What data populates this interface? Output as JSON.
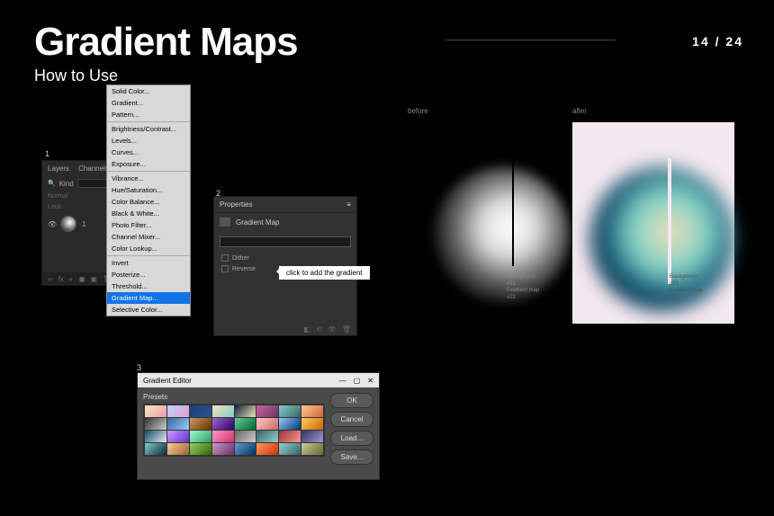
{
  "header": {
    "title": "Gradient Maps",
    "subtitle": "How to Use"
  },
  "page": {
    "current": "14",
    "sep": " / ",
    "total": "24"
  },
  "steps": {
    "s1": "1",
    "s2": "2",
    "s3": "3"
  },
  "layers": {
    "tab1": "Layers",
    "tab2": "Channels",
    "kind_label": "Kind",
    "blend": "Normal",
    "lock": "Lock:",
    "layer_name": "1",
    "footer_icons": [
      "∞",
      "fx",
      "◐",
      "◼",
      "▣",
      "🗑"
    ]
  },
  "context_menu": {
    "items": [
      "Solid Color...",
      "Gradient...",
      "Pattern...",
      "Brightness/Contrast...",
      "Levels...",
      "Curves...",
      "Exposure...",
      "Vibrance...",
      "Hue/Saturation...",
      "Color Balance...",
      "Black & White...",
      "Photo Filter...",
      "Channel Mixer...",
      "Color Lookup...",
      "Invert",
      "Posterize...",
      "Threshold...",
      "Gradient Map...",
      "Selective Color..."
    ],
    "highlighted_index": 17,
    "separators_after": [
      2,
      6,
      13
    ]
  },
  "properties": {
    "title": "Properties",
    "sub": "Gradient Map",
    "dither": "Dither",
    "reverse": "Reverse",
    "tooltip": "click to add the gradient"
  },
  "gradient_editor": {
    "title": "Gradient Editor",
    "min": "—",
    "max": "▢",
    "close": "✕",
    "presets_label": "Presets",
    "buttons": {
      "ok": "OK",
      "cancel": "Cancel",
      "load": "Load...",
      "save": "Save..."
    },
    "swatches": [
      "linear-gradient(135deg,#fce9b5,#e89cb5)",
      "linear-gradient(135deg,#b5d7fc,#e89ccc)",
      "linear-gradient(135deg,#1e3c72,#2a5298)",
      "linear-gradient(135deg,#f5e0b5,#7dd0c8)",
      "linear-gradient(135deg,#0a2540,#f5e0b5)",
      "linear-gradient(135deg,#cc6699,#663366)",
      "linear-gradient(135deg,#88cccc,#336666)",
      "linear-gradient(135deg,#ffcc99,#cc6633)",
      "linear-gradient(135deg,#333,#ccc)",
      "linear-gradient(135deg,#336699,#99ccff)",
      "linear-gradient(135deg,#cc9966,#663300)",
      "linear-gradient(135deg,#9966cc,#330066)",
      "linear-gradient(135deg,#66cc99,#006633)",
      "linear-gradient(135deg,#ffcccc,#cc6666)",
      "linear-gradient(135deg,#99ccff,#003366)",
      "linear-gradient(135deg,#ffcc66,#cc6600)",
      "linear-gradient(135deg,#0e4d6b,#f4e8f0)",
      "linear-gradient(135deg,#cc99ff,#6633cc)",
      "linear-gradient(135deg,#99ffcc,#339966)",
      "linear-gradient(135deg,#ff99cc,#cc3366)",
      "linear-gradient(135deg,#666,#ccc)",
      "linear-gradient(135deg,#336666,#99cccc)",
      "linear-gradient(135deg,#993333,#ff9999)",
      "linear-gradient(135deg,#333366,#9999cc)",
      "linear-gradient(135deg,#7dd0c8,#0a2540)",
      "linear-gradient(135deg,#ffcc99,#996633)",
      "linear-gradient(135deg,#99cc66,#336600)",
      "linear-gradient(135deg,#cc99cc,#663366)",
      "linear-gradient(135deg,#6699cc,#003366)",
      "linear-gradient(135deg,#ff9966,#cc3300)",
      "linear-gradient(135deg,#99cccc,#336666)",
      "linear-gradient(135deg,#cccc99,#666633)"
    ]
  },
  "previews": {
    "before_label": "before",
    "after_label": "after",
    "caption_before": "Background\n#31\nGradient map\n#22",
    "caption_after": "Background\n#31\nGradient map\n#22"
  }
}
